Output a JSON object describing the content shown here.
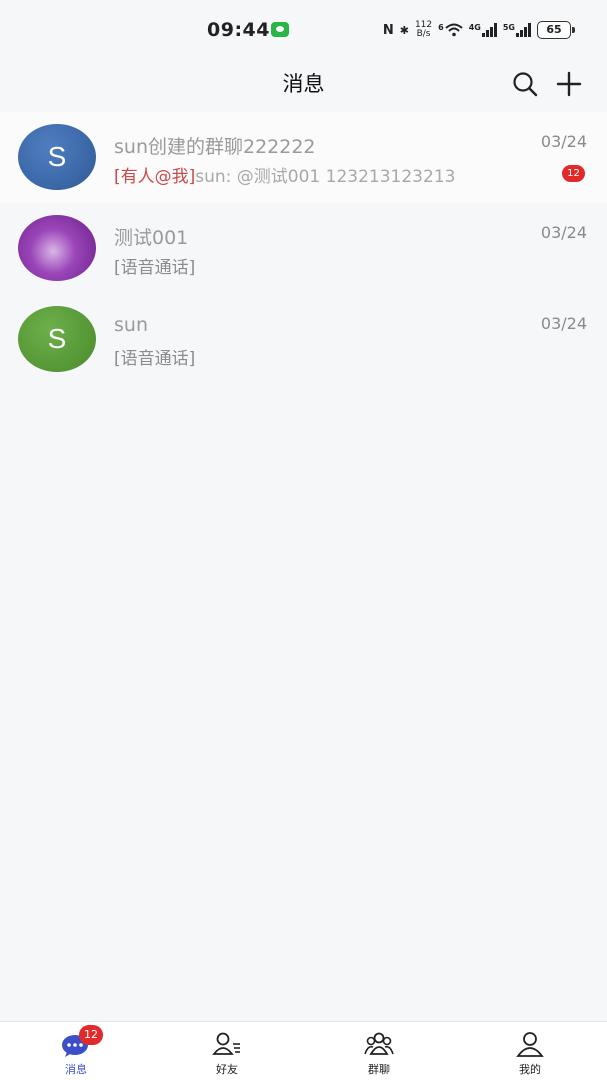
{
  "status_bar": {
    "time": "09:44",
    "nfc": "N",
    "bluetooth": "✱",
    "speed_value": "112",
    "speed_unit": "B/s",
    "wifi_label": "6",
    "net1": "4G",
    "net2": "5G",
    "battery": "65"
  },
  "header": {
    "title": "消息",
    "search_icon": "search-icon",
    "add_icon": "plus-icon"
  },
  "conversations": [
    {
      "avatar_letter": "S",
      "avatar_color": "#3d6aa8",
      "name": "sun创建的群聊222222",
      "mention_tag": "[有人@我]",
      "preview": "sun: @测试001 123213123213",
      "time": "03/24",
      "badge": "12"
    },
    {
      "avatar_letter": "",
      "avatar_color": "#7a2b98",
      "name": "测试001",
      "mention_tag": "",
      "preview": "[语音通话]",
      "time": "03/24",
      "badge": ""
    },
    {
      "avatar_letter": "S",
      "avatar_color": "#5a9a3a",
      "name": "sun",
      "mention_tag": "",
      "preview": "[语音通话]",
      "time": "03/24",
      "badge": ""
    }
  ],
  "tab_bar": {
    "tabs": [
      {
        "label": "消息",
        "icon": "chat-bubble-icon",
        "badge": "12",
        "active": true
      },
      {
        "label": "好友",
        "icon": "friend-list-icon",
        "badge": "",
        "active": false
      },
      {
        "label": "群聊",
        "icon": "group-icon",
        "badge": "",
        "active": false
      },
      {
        "label": "我的",
        "icon": "profile-icon",
        "badge": "",
        "active": false
      }
    ]
  },
  "colors": {
    "accent": "#3b4fc7",
    "badge": "#e12a2a",
    "mention": "#c84b4b"
  }
}
